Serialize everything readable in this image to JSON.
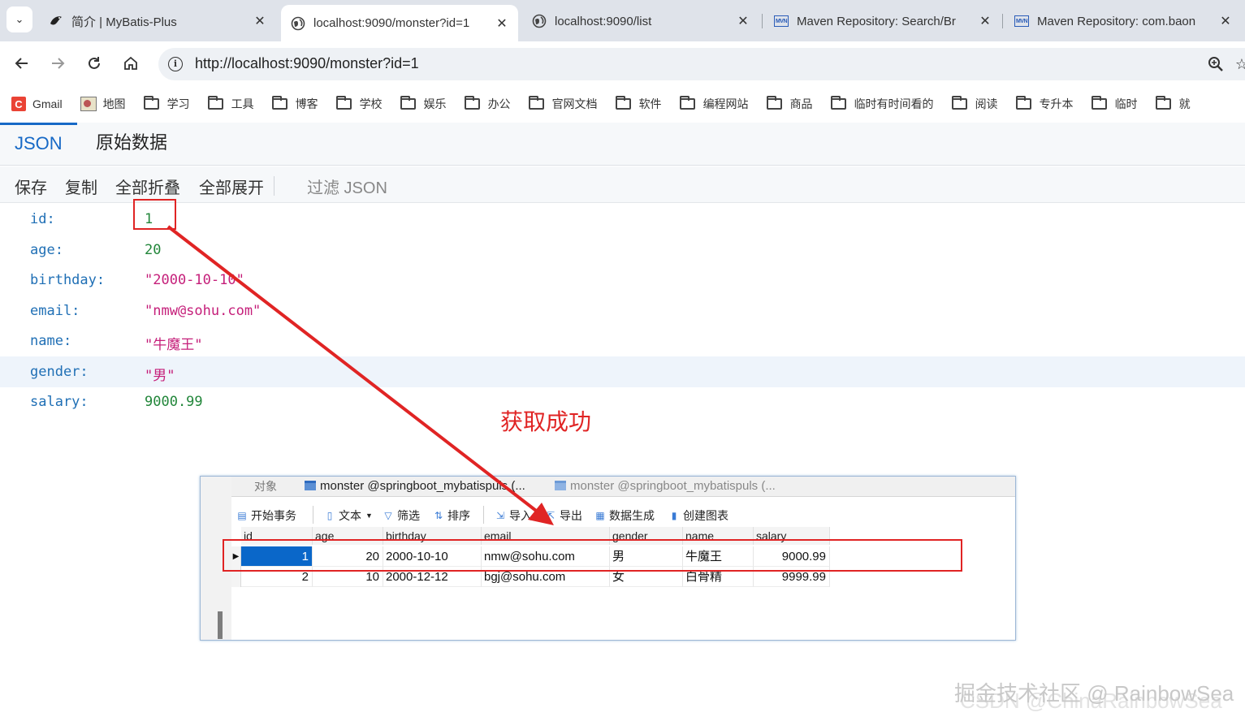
{
  "browser": {
    "tabs": [
      {
        "title": "简介 | MyBatis-Plus",
        "active": false,
        "icon": "mybatis-bird-icon"
      },
      {
        "title": "localhost:9090/monster?id=1",
        "active": true,
        "icon": "globe-icon"
      },
      {
        "title": "localhost:9090/list",
        "active": false,
        "icon": "globe-icon"
      },
      {
        "title": "Maven Repository: Search/Br",
        "active": false,
        "icon": "mvn-icon"
      },
      {
        "title": "Maven Repository: com.baon",
        "active": false,
        "icon": "mvn-icon"
      }
    ],
    "close_glyph": "✕",
    "url": "http://localhost:9090/monster?id=1",
    "bookmarks": [
      "Gmail",
      "地图",
      "学习",
      "工具",
      "博客",
      "学校",
      "娱乐",
      "办公",
      "官网文档",
      "软件",
      "编程网站",
      "商品",
      "临时有时间看的",
      "阅读",
      "专升本",
      "临时",
      "就"
    ]
  },
  "viewer": {
    "tabs": [
      "JSON",
      "原始数据"
    ],
    "actions": [
      "保存",
      "复制",
      "全部折叠",
      "全部展开"
    ],
    "filter_placeholder": "过滤 JSON",
    "rows": [
      {
        "key": "id:",
        "value": "1",
        "type": "num"
      },
      {
        "key": "age:",
        "value": "20",
        "type": "num"
      },
      {
        "key": "birthday:",
        "value": "\"2000-10-10\"",
        "type": "str"
      },
      {
        "key": "email:",
        "value": "\"nmw@sohu.com\"",
        "type": "str"
      },
      {
        "key": "name:",
        "value": "\"牛魔王\"",
        "type": "str"
      },
      {
        "key": "gender:",
        "value": "\"男\"",
        "type": "str"
      },
      {
        "key": "salary:",
        "value": "9000.99",
        "type": "num"
      }
    ]
  },
  "annotation": {
    "text": "获取成功",
    "color": "#e02424"
  },
  "db_window": {
    "tabs": [
      "对象",
      "monster @springboot_mybatispuls (...",
      "monster @springboot_mybatispuls (..."
    ],
    "toolbar": [
      "开始事务",
      "文本",
      "筛选",
      "排序",
      "导入",
      "导出",
      "数据生成",
      "创建图表"
    ],
    "columns": [
      "id",
      "age",
      "birthday",
      "email",
      "gender",
      "name",
      "salary"
    ],
    "rows": [
      [
        "1",
        "20",
        "2000-10-10",
        "nmw@sohu.com",
        "男",
        "牛魔王",
        "9000.99"
      ],
      [
        "2",
        "10",
        "2000-12-12",
        "bgj@sohu.com",
        "女",
        "白骨精",
        "9999.99"
      ]
    ]
  },
  "watermark": [
    "掘金技术社区 @ RainbowSea",
    "CSDN @ChinaRainbowSea"
  ]
}
